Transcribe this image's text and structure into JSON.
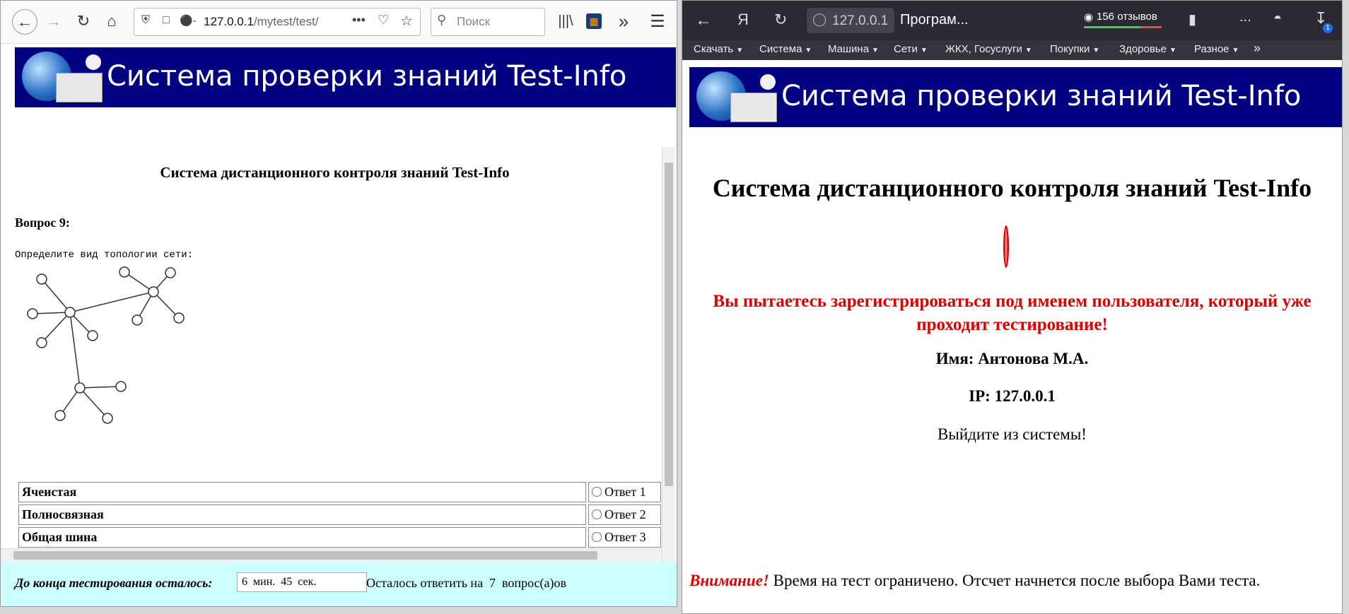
{
  "left_browser": {
    "url_host": "127.0.0.1",
    "url_path": "/mytest/test/",
    "search_placeholder": "Поиск",
    "banner_title": "Система проверки знаний Test-Info",
    "page_heading": "Система дистанционного контроля знаний Test-Info",
    "question_label": "Вопрос 9:",
    "question_text": "Определите вид топологии сети:",
    "answers": [
      {
        "text": "Ячеистая",
        "option": "Ответ 1"
      },
      {
        "text": "Полносвязная",
        "option": "Ответ 2"
      },
      {
        "text": "Общая шина",
        "option": "Ответ 3"
      }
    ],
    "footer": {
      "time_label": "До конца тестирования осталось:",
      "time_value": "6  мин.  45  сек.",
      "remaining_text": "Осталось ответить на  7  вопрос(а)ов"
    }
  },
  "right_browser": {
    "address": "127.0.0.1",
    "tab_title": "Програм...",
    "reviews": "156 отзывов",
    "ellipsis": "...",
    "download_badge": "1",
    "bookmarks": [
      "Скачать",
      "Система",
      "Машина",
      "Сети",
      "ЖКХ, Госуслуги",
      "Покупки",
      "Здоровье",
      "Разное"
    ],
    "overflow": "»",
    "banner_title": "Система проверки знаний Test-Info",
    "page_heading": "Система дистанционного контроля знаний Test-Info",
    "warning": "Вы пытаетесь зарегистрироваться под именем пользователя, который уже проходит тестирование!",
    "name_line": "Имя: Антонова М.А.",
    "ip_line": "IP: 127.0.0.1",
    "logout_text": "Выйдите из системы!",
    "notice_label": "Внимание!",
    "notice_text": " Время на тест ограничено. Отсчет начнется после выбора Вами теста."
  },
  "colors": {
    "banner_bg": "#000080",
    "warning_red": "#e00000",
    "footer_bg": "#ccffff",
    "yandex_bar": "#2b2a33"
  }
}
